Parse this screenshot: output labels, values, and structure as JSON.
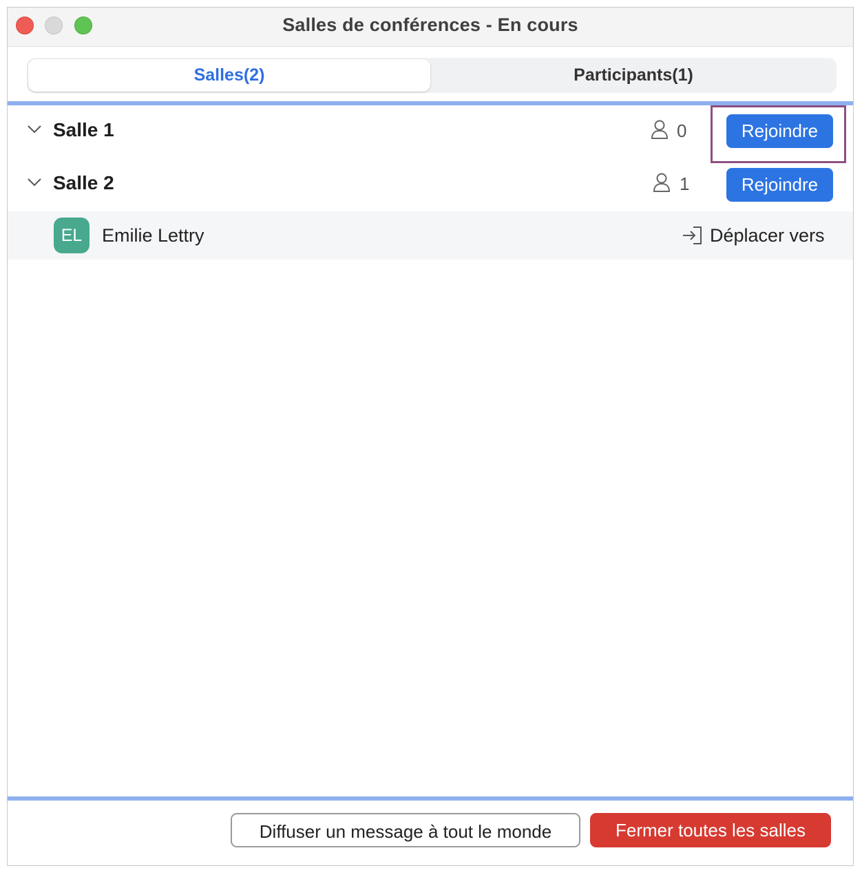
{
  "window": {
    "title": "Salles de conférences - En cours"
  },
  "tabs": [
    {
      "label": "Salles(2)",
      "active": true
    },
    {
      "label": "Participants(1)",
      "active": false
    }
  ],
  "rooms": [
    {
      "name": "Salle 1",
      "count": "0",
      "join_label": "Rejoindre",
      "icons": [
        "chevron-down-icon",
        "person-icon"
      ]
    },
    {
      "name": "Salle 2",
      "count": "1",
      "join_label": "Rejoindre",
      "icons": [
        "chevron-down-icon",
        "person-icon"
      ]
    }
  ],
  "participants": [
    {
      "initials": "EL",
      "name": "Emilie Lettry",
      "move_label": "Déplacer vers",
      "avatar_color": "#48a98f"
    }
  ],
  "footer": {
    "broadcast_label": "Diffuser un message à tout le monde",
    "close_all_label": "Fermer toutes les salles"
  },
  "colors": {
    "accent": "#2d74e3",
    "danger": "#d63a31",
    "highlight": "#8e4e82",
    "divider": "#8fb0ee"
  }
}
